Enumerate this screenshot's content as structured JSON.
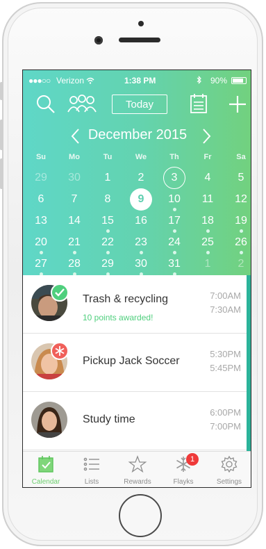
{
  "status_bar": {
    "signal": "●●●○○",
    "carrier": "Verizon",
    "time": "1:38 PM",
    "battery_text": "90%",
    "battery_level": 0.9
  },
  "toolbar": {
    "search_icon": "search-icon",
    "family_icon": "family-icon",
    "today_label": "Today",
    "calendar_list_icon": "calendar-list-icon",
    "add_icon": "plus-icon"
  },
  "calendar": {
    "month_label": "December 2015",
    "weekdays": [
      "Su",
      "Mo",
      "Tu",
      "We",
      "Th",
      "Fr",
      "Sa"
    ],
    "weeks": [
      [
        {
          "d": "29",
          "faded": true
        },
        {
          "d": "30",
          "faded": true
        },
        {
          "d": "1"
        },
        {
          "d": "2"
        },
        {
          "d": "3",
          "today": true
        },
        {
          "d": "4"
        },
        {
          "d": "5"
        }
      ],
      [
        {
          "d": "6"
        },
        {
          "d": "7"
        },
        {
          "d": "8"
        },
        {
          "d": "9",
          "selected": true
        },
        {
          "d": "10",
          "dot": true
        },
        {
          "d": "11"
        },
        {
          "d": "12"
        }
      ],
      [
        {
          "d": "13"
        },
        {
          "d": "14"
        },
        {
          "d": "15",
          "dot": true
        },
        {
          "d": "16"
        },
        {
          "d": "17",
          "dot": true
        },
        {
          "d": "18",
          "dot": true
        },
        {
          "d": "19",
          "dot": true
        }
      ],
      [
        {
          "d": "20",
          "dot": true
        },
        {
          "d": "21",
          "dot": true
        },
        {
          "d": "22",
          "dot": true
        },
        {
          "d": "23",
          "dot": true
        },
        {
          "d": "24",
          "dot": true
        },
        {
          "d": "25",
          "dot": true
        },
        {
          "d": "26",
          "dot": true
        }
      ],
      [
        {
          "d": "27",
          "dot": true
        },
        {
          "d": "28",
          "dot": true
        },
        {
          "d": "29",
          "dot": true
        },
        {
          "d": "30",
          "dot": true
        },
        {
          "d": "31",
          "dot": true
        },
        {
          "d": "1",
          "faded": true
        },
        {
          "d": "2",
          "faded": true
        }
      ]
    ]
  },
  "events": [
    {
      "title": "Trash & recycling",
      "subtitle": "10 points awarded!",
      "start": "7:00AM",
      "end": "7:30AM",
      "badge": "check-badge-icon",
      "badge_color": "#4fcf7d"
    },
    {
      "title": "Pickup Jack Soccer",
      "subtitle": "",
      "start": "5:30PM",
      "end": "5:45PM",
      "badge": "snowflake-badge-icon",
      "badge_color": "#f0605a"
    },
    {
      "title": "Study time",
      "subtitle": "",
      "start": "6:00PM",
      "end": "7:00PM",
      "badge": "",
      "badge_color": ""
    }
  ],
  "tabs": [
    {
      "label": "Calendar",
      "icon": "calendar-check-icon",
      "active": true
    },
    {
      "label": "Lists",
      "icon": "list-icon"
    },
    {
      "label": "Rewards",
      "icon": "star-icon"
    },
    {
      "label": "Flayks",
      "icon": "snowflake-icon",
      "badge": "1"
    },
    {
      "label": "Settings",
      "icon": "gear-icon"
    }
  ],
  "colors": {
    "header_start": "#5fd7c7",
    "header_end": "#72d17e",
    "accent": "#2bb39a",
    "active_tab": "#6ccf6e",
    "badge": "#ef3a3a"
  }
}
